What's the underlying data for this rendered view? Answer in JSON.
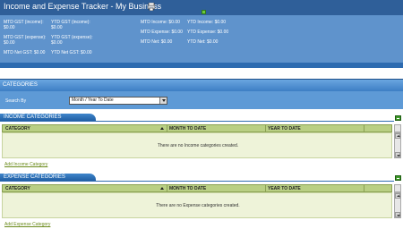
{
  "header": {
    "title": "Income and Expense Tracker -  My Business",
    "stats": {
      "mtd_gst_income": "MTD GST (income):",
      "mtd_gst_income_val": "$0.00",
      "ytd_gst_income": "YTD GST (income):",
      "ytd_gst_income_val": "$0.00",
      "mtd_gst_expense": "MTD GST (expense):",
      "mtd_gst_expense_val": "$0.00",
      "ytd_gst_expense": "YTD GST (expense):",
      "ytd_gst_expense_val": "$0.00",
      "mtd_net_gst": "MTD Net GST:  $0.00",
      "ytd_net_gst": "YTD Net GST:  $0.00",
      "mtd_income": "MTD Income:  $0.00",
      "ytd_income": "YTD Income:  $0.00",
      "mtd_expense": "MTD Expense:  $0.00",
      "ytd_expense": "YTD Expense:  $0.00",
      "mtd_net": "MTD Net:  $0.00",
      "ytd_net": "YTD Net:  $0.00"
    }
  },
  "categories": {
    "title": "CATEGORIES",
    "search_label": "Search By",
    "search_value": "Month / Year To Date"
  },
  "income": {
    "title": "INCOME CATEGORIES",
    "columns": [
      "CATEGORY",
      "MONTH TO DATE",
      "YEAR TO DATE"
    ],
    "empty_message": "There are no Income categories created.",
    "add_link": "Add Income Category"
  },
  "expense": {
    "title": "EXPENSE CATEGORIES",
    "columns": [
      "CATEGORY",
      "MONTH TO DATE",
      "YEAR TO DATE"
    ],
    "empty_message": "There are no Expense categories created.",
    "add_link": "Add Expense Category"
  }
}
